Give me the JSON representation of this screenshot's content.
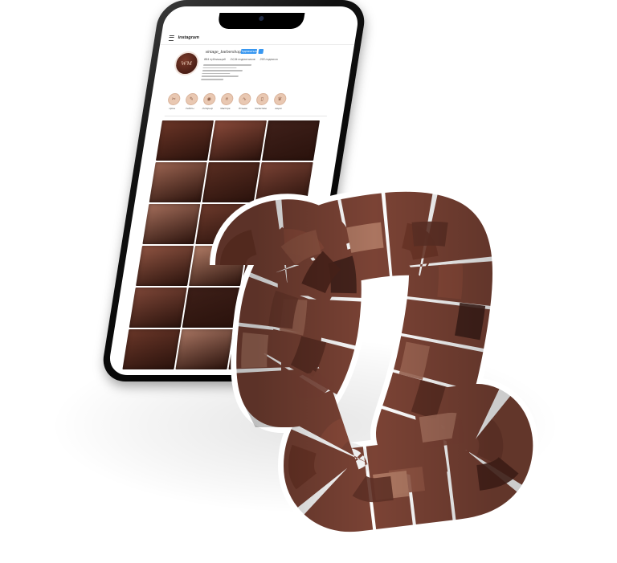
{
  "app": {
    "title": "Instagram",
    "username": "vintage_barbershop",
    "follow_label": "Подписаться",
    "avatar_monogram": "WM",
    "stats": [
      "884 публикаций",
      "24,5k подписчиков",
      "293 подписок"
    ]
  },
  "highlights": [
    {
      "icon_name": "scissors-icon",
      "label": "Цены"
    },
    {
      "icon_name": "razor-icon",
      "label": "Работы"
    },
    {
      "icon_name": "camera-icon",
      "label": "Интерьер"
    },
    {
      "icon_name": "comb-icon",
      "label": "Мастера"
    },
    {
      "icon_name": "mustache-icon",
      "label": "Отзывы"
    },
    {
      "icon_name": "bottle-icon",
      "label": "Косметика"
    },
    {
      "icon_name": "crown-icon",
      "label": "Акции"
    }
  ],
  "grid_tiles": [
    "#6b3527",
    "#8a4a3a",
    "#3f201a",
    "#9c6552",
    "#5a2e22",
    "#7b4335",
    "#a46e5b",
    "#6d3a2c",
    "#4a241b",
    "#8f5442",
    "#b07b65",
    "#5e3126",
    "#7e4738",
    "#3d1f18",
    "#9a604d",
    "#6a3729",
    "#a87562",
    "#51291f"
  ],
  "ribbon_tiles": [
    "#6b3527",
    "#8a4a3a",
    "#3f201a",
    "#9c6552",
    "#5a2e22",
    "#7b4335",
    "#a46e5b",
    "#6d3a2c",
    "#4a241b",
    "#8f5442",
    "#b07b65",
    "#5e3126"
  ],
  "colors": {
    "accent": "#3897f0",
    "photo_tone": "#7b4335",
    "phone_frame": "#111111"
  }
}
